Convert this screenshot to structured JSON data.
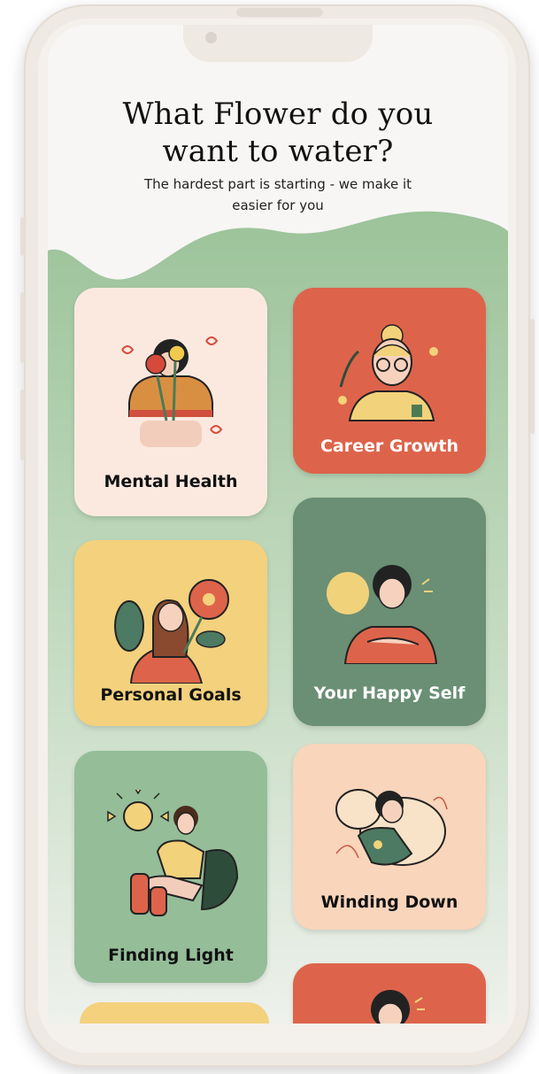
{
  "header": {
    "title_line1": "What Flower do you",
    "title_line2": "want to water?",
    "subtitle_line1": "The hardest part is starting - we make it",
    "subtitle_line2": "easier for you"
  },
  "colors": {
    "wave_top": "#9cc39a",
    "wave_bottom": "#e6ece3",
    "cream": "#fbe9df",
    "red": "#dd644b",
    "yellow": "#f3d17d",
    "dark_green": "#6a8f74",
    "sage": "#94bd98",
    "peach": "#f8d5bb"
  },
  "cards": [
    {
      "label": "Mental Health",
      "bg": "#fbe9df",
      "text_color": "#111111",
      "illustration": "woman-holding-flowers-illustration"
    },
    {
      "label": "Career Growth",
      "bg": "#dd644b",
      "text_color": "#ffffff",
      "illustration": "woman-with-glasses-illustration"
    },
    {
      "label": "Personal Goals",
      "bg": "#f3d17d",
      "text_color": "#111111",
      "illustration": "woman-with-red-flower-illustration"
    },
    {
      "label": "Your Happy Self",
      "bg": "#6a8f74",
      "text_color": "#ffffff",
      "illustration": "woman-hugging-self-illustration"
    },
    {
      "label": "Finding Light",
      "bg": "#94bd98",
      "text_color": "#111111",
      "illustration": "woman-in-sunshine-illustration"
    },
    {
      "label": "Winding Down",
      "bg": "#f8d5bb",
      "text_color": "#111111",
      "illustration": "woman-resting-on-pillow-illustration"
    }
  ]
}
